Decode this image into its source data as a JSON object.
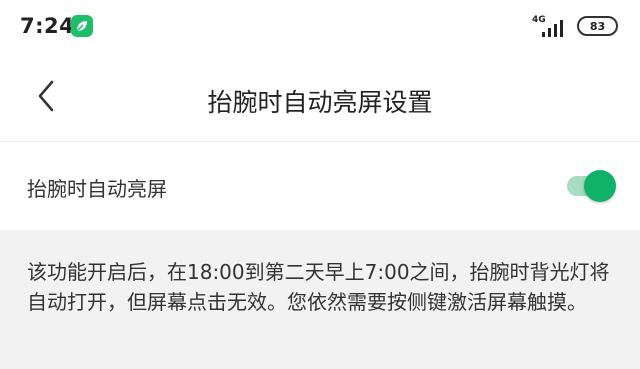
{
  "status_bar": {
    "time": "7:24",
    "app_icon": "leaf-app-icon",
    "network_type": "4G",
    "battery_level": "83"
  },
  "header": {
    "title": "抬腕时自动亮屏设置",
    "back_icon": "chevron-left-icon"
  },
  "setting": {
    "label": "抬腕时自动亮屏",
    "enabled": true
  },
  "info": {
    "text": "该功能开启后，在18:00到第二天早上7:00之间，抬腕时背光灯将自动打开，但屏幕点击无效。您依然需要按侧键激活屏幕触摸。"
  },
  "colors": {
    "accent": "#10b268",
    "toggle_track": "#a8dcc0",
    "info_background": "#f2f2f2"
  }
}
